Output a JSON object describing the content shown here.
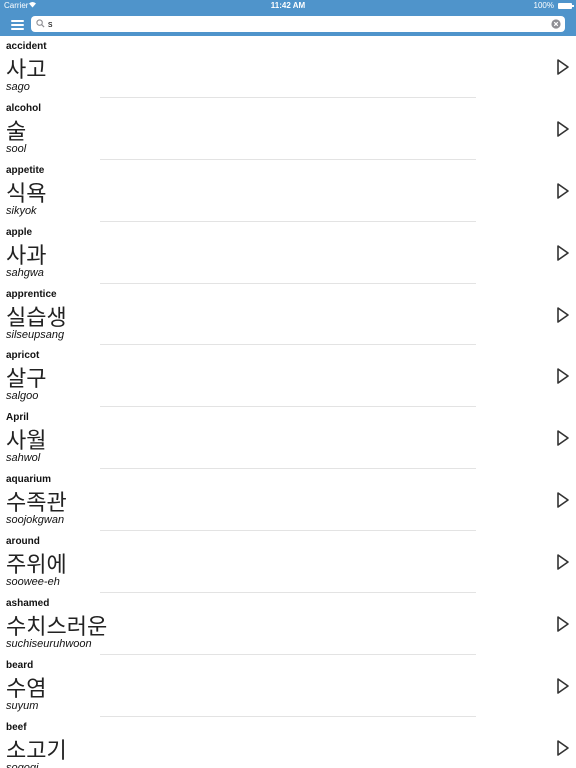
{
  "status_bar": {
    "carrier": "Carrier",
    "wifi_icon": "wifi-icon",
    "time": "11:42 AM",
    "battery": "100%",
    "battery_icon": "battery-icon"
  },
  "nav": {
    "menu_icon": "hamburger-menu-icon",
    "search": {
      "value": "s",
      "placeholder": "",
      "search_icon": "magnifier-icon",
      "clear_icon": "clear-circle-icon"
    }
  },
  "words": [
    {
      "english": "accident",
      "korean": "사고",
      "roman": "sago"
    },
    {
      "english": "alcohol",
      "korean": "술",
      "roman": "sool"
    },
    {
      "english": "appetite",
      "korean": "식욕",
      "roman": "sikyok"
    },
    {
      "english": "apple",
      "korean": "사과",
      "roman": "sahgwa"
    },
    {
      "english": "apprentice",
      "korean": "실습생",
      "roman": "silseupsang"
    },
    {
      "english": "apricot",
      "korean": "살구",
      "roman": "salgoo"
    },
    {
      "english": "April",
      "korean": "사월",
      "roman": "sahwol"
    },
    {
      "english": "aquarium",
      "korean": "수족관",
      "roman": "soojokgwan"
    },
    {
      "english": "around",
      "korean": "주위에",
      "roman": "soowee-eh"
    },
    {
      "english": "ashamed",
      "korean": "수치스러운",
      "roman": "suchiseuruhwoon"
    },
    {
      "english": "beard",
      "korean": "수염",
      "roman": "suyum"
    },
    {
      "english": "beef",
      "korean": "소고기",
      "roman": "sogogi"
    }
  ],
  "colors": {
    "nav_background": "#4f94cb",
    "divider": "#e3e3e3",
    "play_icon": "#333333"
  },
  "row_icon": "play-triangle-icon"
}
